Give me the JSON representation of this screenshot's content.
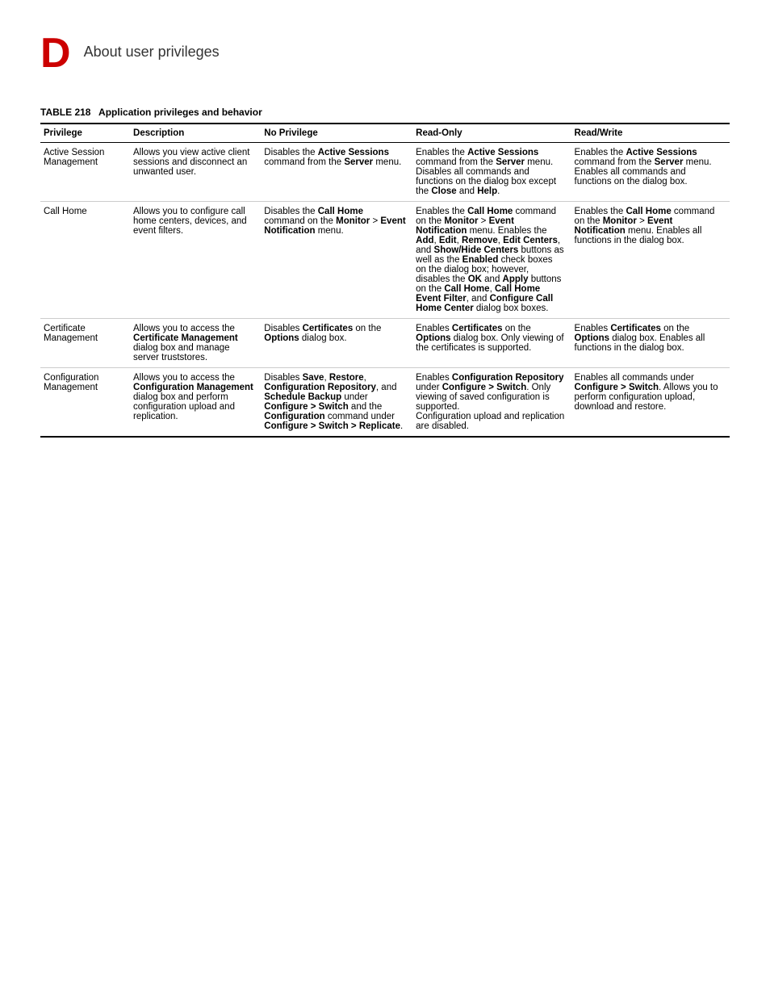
{
  "header": {
    "letter": "D",
    "title": "About user privileges"
  },
  "table": {
    "id": "TABLE 218",
    "caption": "Application privileges and behavior",
    "columns": [
      "Privilege",
      "Description",
      "No Privilege",
      "Read-Only",
      "Read/Write"
    ],
    "rows": [
      {
        "privilege": "Active Session Management",
        "description": "Allows you view active client sessions and disconnect an unwanted user.",
        "no_privilege": [
          {
            "text": "Disables the ",
            "bold": false
          },
          {
            "text": "Active Sessions",
            "bold": true
          },
          {
            "text": " command from the ",
            "bold": false
          },
          {
            "text": "Server",
            "bold": true
          },
          {
            "text": " menu.",
            "bold": false
          }
        ],
        "read_only": [
          {
            "text": "Enables the ",
            "bold": false
          },
          {
            "text": "Active Sessions",
            "bold": true
          },
          {
            "text": " command from the ",
            "bold": false
          },
          {
            "text": "Server",
            "bold": true
          },
          {
            "text": " menu.",
            "bold": false
          },
          {
            "text": "\nDisables all commands and functions on the dialog box except the ",
            "bold": false
          },
          {
            "text": "Close",
            "bold": true
          },
          {
            "text": " and ",
            "bold": false
          },
          {
            "text": "Help",
            "bold": true
          },
          {
            "text": ".",
            "bold": false
          }
        ],
        "read_write": [
          {
            "text": "Enables the ",
            "bold": false
          },
          {
            "text": "Active Sessions",
            "bold": true
          },
          {
            "text": " command from the ",
            "bold": false
          },
          {
            "text": "Server",
            "bold": true
          },
          {
            "text": " menu.",
            "bold": false
          },
          {
            "text": "\nEnables all commands and functions on the dialog box.",
            "bold": false
          }
        ]
      },
      {
        "privilege": "Call Home",
        "description": "Allows you to configure call home centers, devices, and event filters.",
        "no_privilege": [
          {
            "text": "Disables the ",
            "bold": false
          },
          {
            "text": "Call Home",
            "bold": true
          },
          {
            "text": " command on the ",
            "bold": false
          },
          {
            "text": "Monitor",
            "bold": true
          },
          {
            "text": " > ",
            "bold": false
          },
          {
            "text": "Event Notification",
            "bold": true
          },
          {
            "text": " menu.",
            "bold": false
          }
        ],
        "read_only": [
          {
            "text": "Enables the ",
            "bold": false
          },
          {
            "text": "Call Home",
            "bold": true
          },
          {
            "text": " command on the ",
            "bold": false
          },
          {
            "text": "Monitor",
            "bold": true
          },
          {
            "text": " > ",
            "bold": false
          },
          {
            "text": "Event Notification",
            "bold": true
          },
          {
            "text": " menu. Enables the ",
            "bold": false
          },
          {
            "text": "Add",
            "bold": true
          },
          {
            "text": ", ",
            "bold": false
          },
          {
            "text": "Edit",
            "bold": true
          },
          {
            "text": ", ",
            "bold": false
          },
          {
            "text": "Remove",
            "bold": true
          },
          {
            "text": ", ",
            "bold": false
          },
          {
            "text": "Edit Centers",
            "bold": true
          },
          {
            "text": ", and ",
            "bold": false
          },
          {
            "text": "Show/Hide Centers",
            "bold": true
          },
          {
            "text": " buttons as well as the ",
            "bold": false
          },
          {
            "text": "Enabled",
            "bold": true
          },
          {
            "text": " check boxes on the dialog box; however, disables the ",
            "bold": false
          },
          {
            "text": "OK",
            "bold": true
          },
          {
            "text": " and ",
            "bold": false
          },
          {
            "text": "Apply",
            "bold": true
          },
          {
            "text": " buttons on the ",
            "bold": false
          },
          {
            "text": "Call Home",
            "bold": true
          },
          {
            "text": ", ",
            "bold": false
          },
          {
            "text": "Call Home Event Filter",
            "bold": true
          },
          {
            "text": ", and ",
            "bold": false
          },
          {
            "text": "Configure Call Home Center",
            "bold": true
          },
          {
            "text": " dialog box boxes.",
            "bold": false
          }
        ],
        "read_write": [
          {
            "text": "Enables the ",
            "bold": false
          },
          {
            "text": "Call Home",
            "bold": true
          },
          {
            "text": " command on the ",
            "bold": false
          },
          {
            "text": "Monitor",
            "bold": true
          },
          {
            "text": " > ",
            "bold": false
          },
          {
            "text": "Event Notification",
            "bold": true
          },
          {
            "text": " menu. Enables all functions in the dialog box.",
            "bold": false
          }
        ]
      },
      {
        "privilege": "Certificate Management",
        "description": "Allows you to access the Certificate Management dialog box and manage server truststores.",
        "description_bold": [
          "Certificate Management"
        ],
        "no_privilege": [
          {
            "text": "Disables ",
            "bold": false
          },
          {
            "text": "Certificates",
            "bold": true
          },
          {
            "text": " on the ",
            "bold": false
          },
          {
            "text": "Options",
            "bold": true
          },
          {
            "text": " dialog box.",
            "bold": false
          }
        ],
        "read_only": [
          {
            "text": "Enables ",
            "bold": false
          },
          {
            "text": "Certificates",
            "bold": true
          },
          {
            "text": " on the ",
            "bold": false
          },
          {
            "text": "Options",
            "bold": true
          },
          {
            "text": " dialog box. Only viewing of the certificates is supported.",
            "bold": false
          }
        ],
        "read_write": [
          {
            "text": "Enables ",
            "bold": false
          },
          {
            "text": "Certificates",
            "bold": true
          },
          {
            "text": " on the ",
            "bold": false
          },
          {
            "text": "Options",
            "bold": true
          },
          {
            "text": " dialog box. Enables all functions in the dialog box.",
            "bold": false
          }
        ]
      },
      {
        "privilege": "Configuration Management",
        "description": "Allows you to access the Configuration Management dialog box and perform configuration upload and replication.",
        "description_bold": [
          "Configuration Management"
        ],
        "no_privilege": [
          {
            "text": "Disables ",
            "bold": false
          },
          {
            "text": "Save",
            "bold": true
          },
          {
            "text": ", ",
            "bold": false
          },
          {
            "text": "Restore",
            "bold": true
          },
          {
            "text": ", ",
            "bold": false
          },
          {
            "text": "Configuration Repository",
            "bold": true
          },
          {
            "text": ", and ",
            "bold": false
          },
          {
            "text": "Schedule Backup",
            "bold": true
          },
          {
            "text": " under ",
            "bold": false
          },
          {
            "text": "Configure > Switch",
            "bold": true
          },
          {
            "text": " and the ",
            "bold": false
          },
          {
            "text": "Configuration",
            "bold": true
          },
          {
            "text": " command under ",
            "bold": false
          },
          {
            "text": "Configure > Switch > Replicate",
            "bold": true
          },
          {
            "text": ".",
            "bold": false
          }
        ],
        "read_only": [
          {
            "text": "Enables ",
            "bold": false
          },
          {
            "text": "Configuration Repository",
            "bold": true
          },
          {
            "text": " under ",
            "bold": false
          },
          {
            "text": "Configure > Switch",
            "bold": true
          },
          {
            "text": ". Only viewing of saved configuration is supported.",
            "bold": false
          },
          {
            "text": "\nConfiguration upload and replication are disabled.",
            "bold": false
          }
        ],
        "read_write": [
          {
            "text": "Enables all commands under ",
            "bold": false
          },
          {
            "text": "Configure > Switch",
            "bold": true
          },
          {
            "text": ". Allows you to perform configuration upload, download and restore.",
            "bold": false
          }
        ]
      }
    ]
  }
}
